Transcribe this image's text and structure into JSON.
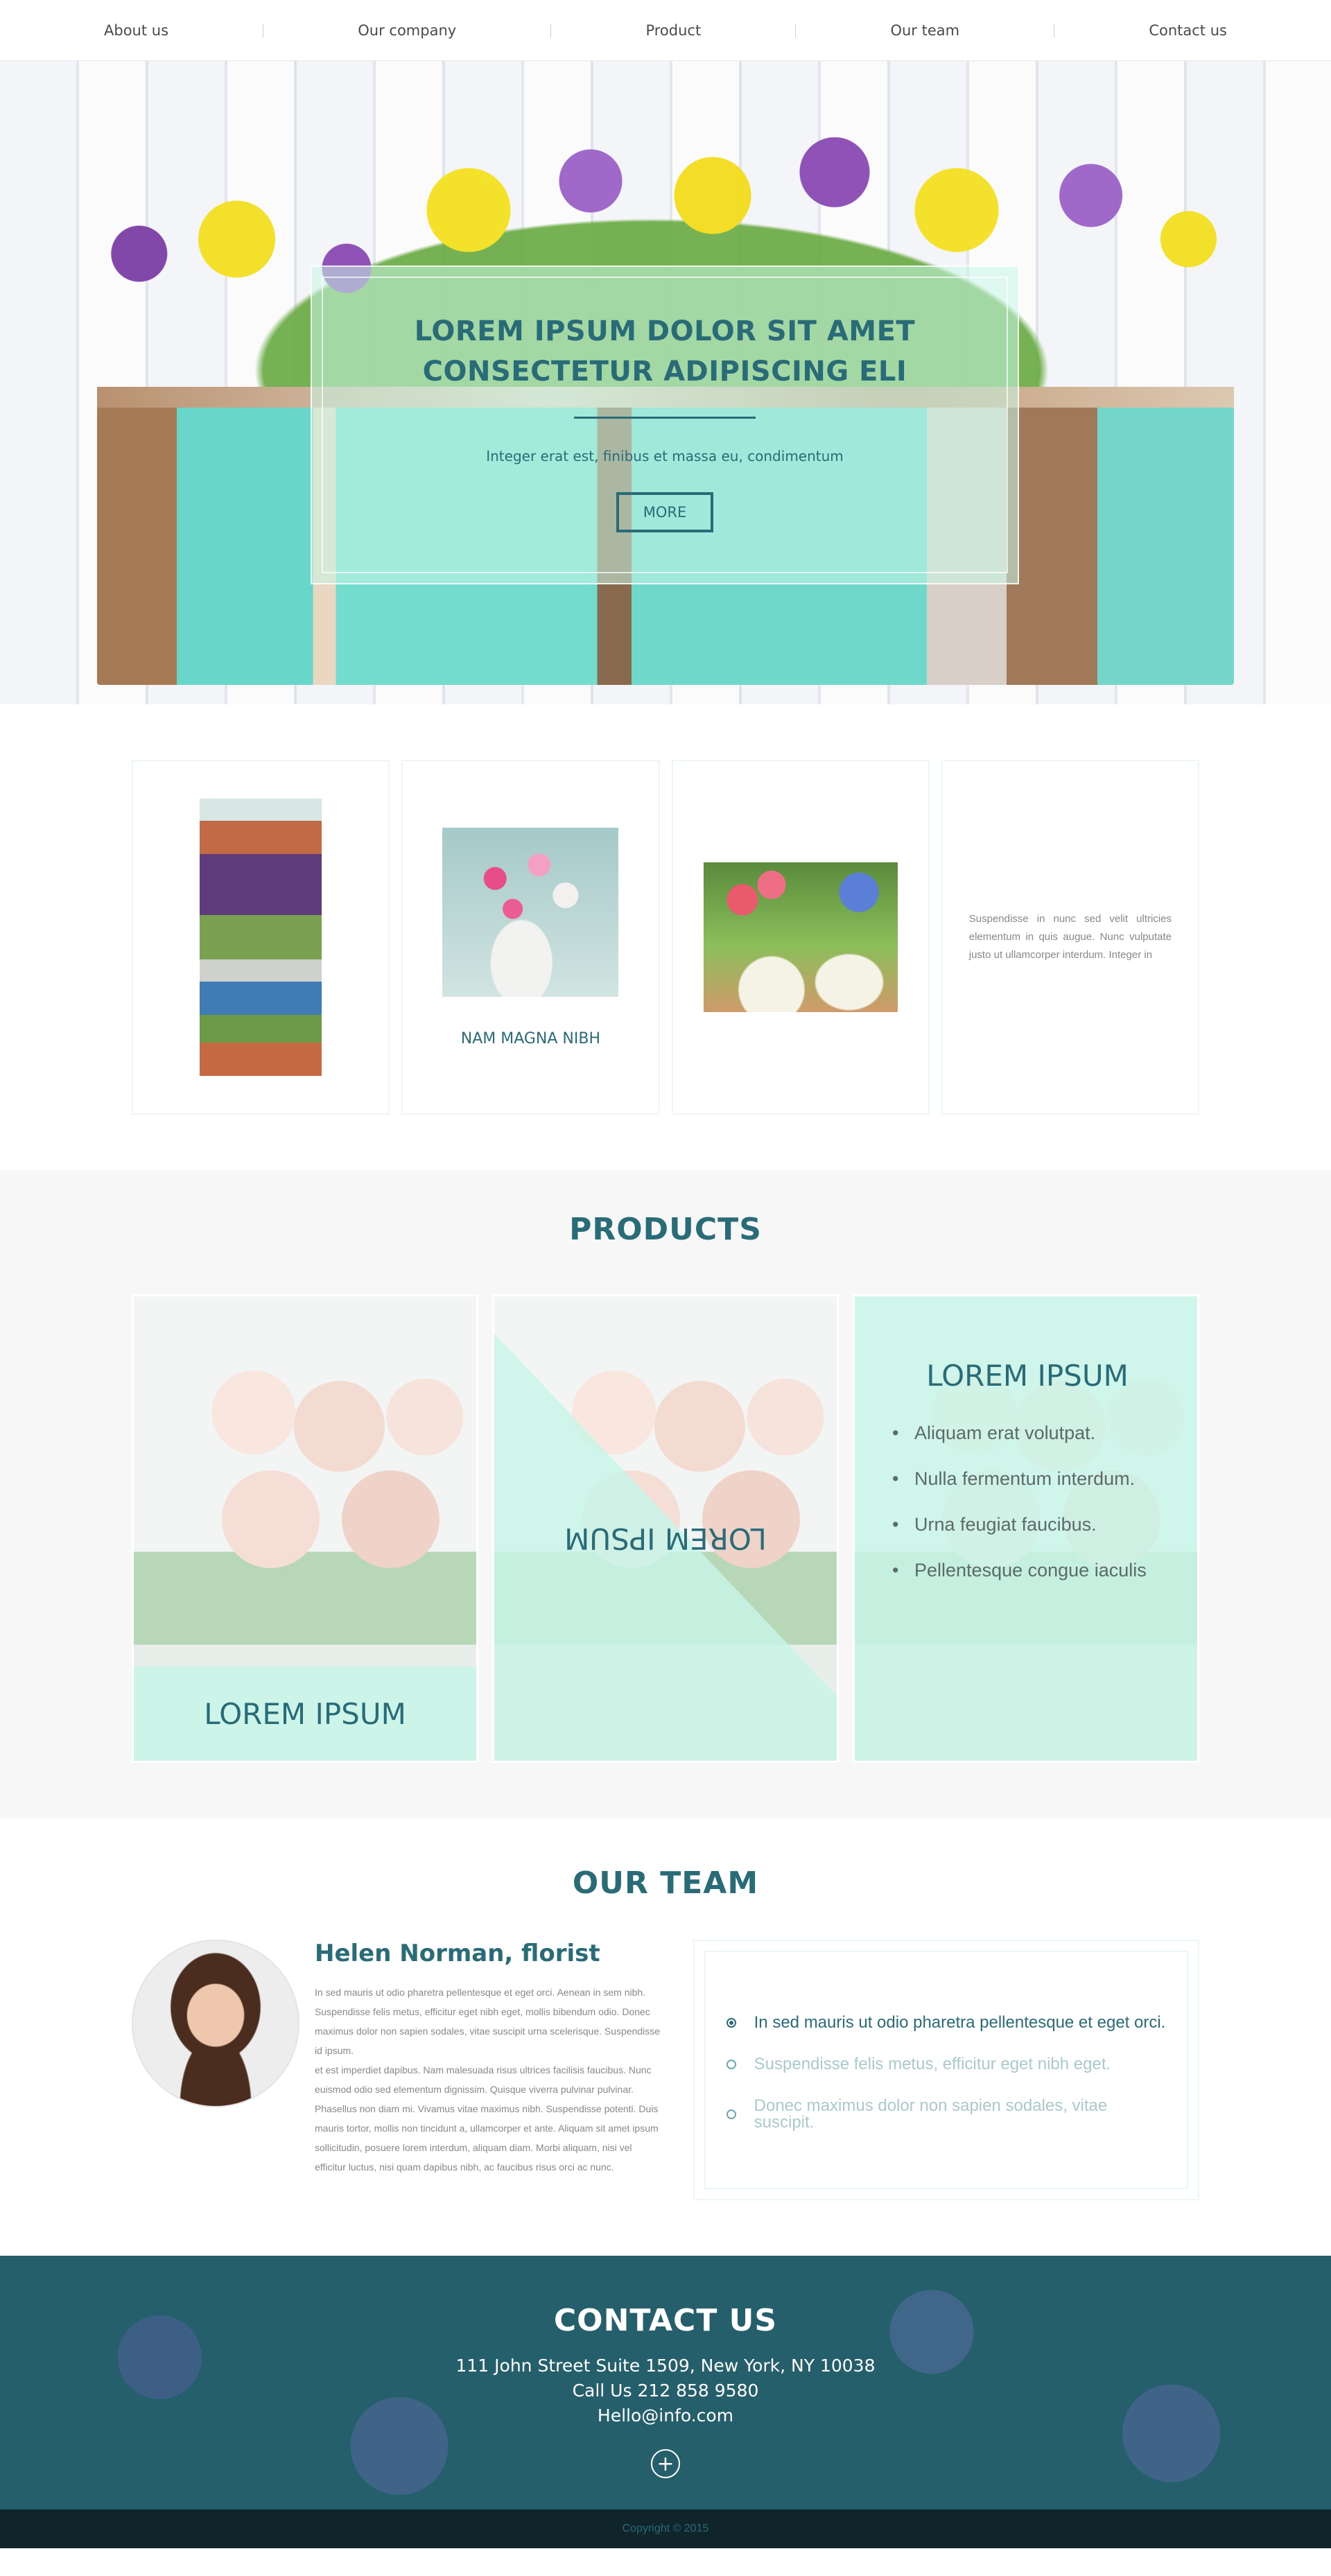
{
  "nav": {
    "items": [
      "About us",
      "Our company",
      "Product",
      "Our team",
      "Contact us"
    ]
  },
  "hero": {
    "title_line1": "LOREM IPSUM DOLOR SIT AMET",
    "title_line2": "CONSECTETUR ADIPISCING ELI",
    "subtitle": "Integer erat est, finibus et massa eu, condimentum",
    "button": "MORE"
  },
  "features": {
    "card2_label": "NAM MAGNA NIBH",
    "card4_text": "Suspendisse in nunc sed velit ultricies elementum in quis augue. Nunc vulputate justo ut ullamcorper interdum. Integer in"
  },
  "products": {
    "title": "PRODUCTS",
    "card1_label": "LOREM IPSUM",
    "card2_label": "LOREM IPSUM",
    "card3_title": "LOREM IPSUM",
    "card3_items": [
      "Aliquam erat volutpat.",
      "Nulla fermentum interdum.",
      "Urna feugiat faucibus.",
      "Pellentesque congue iaculis"
    ]
  },
  "team": {
    "title": "OUR TEAM",
    "name": "Helen Norman, florist",
    "bio_p1": "In sed mauris ut odio pharetra pellentesque et eget orci. Aenean in sem nibh. Suspendisse felis metus, efficitur eget nibh eget, mollis bibendum odio. Donec maximus dolor non sapien sodales, vitae suscipit urna scelerisque. Suspendisse id ipsum.",
    "bio_p2": "et est imperdiet dapibus. Nam malesuada risus ultrices facilisis faucibus. Nunc euismod odio sed elementum dignissim. Quisque viverra pulvinar pulvinar. Phasellus non diam mi. Vivamus vitae maximus nibh. Suspendisse potenti. Duis mauris tortor, mollis non tincidunt a, ullamcorper et ante. Aliquam sit amet ipsum sollicitudin, posuere lorem interdum, aliquam diam. Morbi aliquam, nisi vel efficitur luctus, nisi quam dapibus nibh, ac faucibus risus orci ac nunc.",
    "quotes": [
      "In sed mauris ut odio pharetra pellentesque et eget orci.",
      "Suspendisse felis metus, efficitur eget nibh eget.",
      "Donec maximus dolor non sapien sodales, vitae suscipit."
    ]
  },
  "contact": {
    "title": "CONTACT US",
    "address": "111 John Street Suite 1509, New York, NY 10038",
    "phone": "Call Us 212 858 9580",
    "email": "Hello@info.com",
    "plus": "+"
  },
  "footer": {
    "copyright": "Copyright © 2015"
  },
  "colors": {
    "accent": "#2a6b78",
    "mint": "#c8f5e8",
    "footer": "#0f242b"
  }
}
